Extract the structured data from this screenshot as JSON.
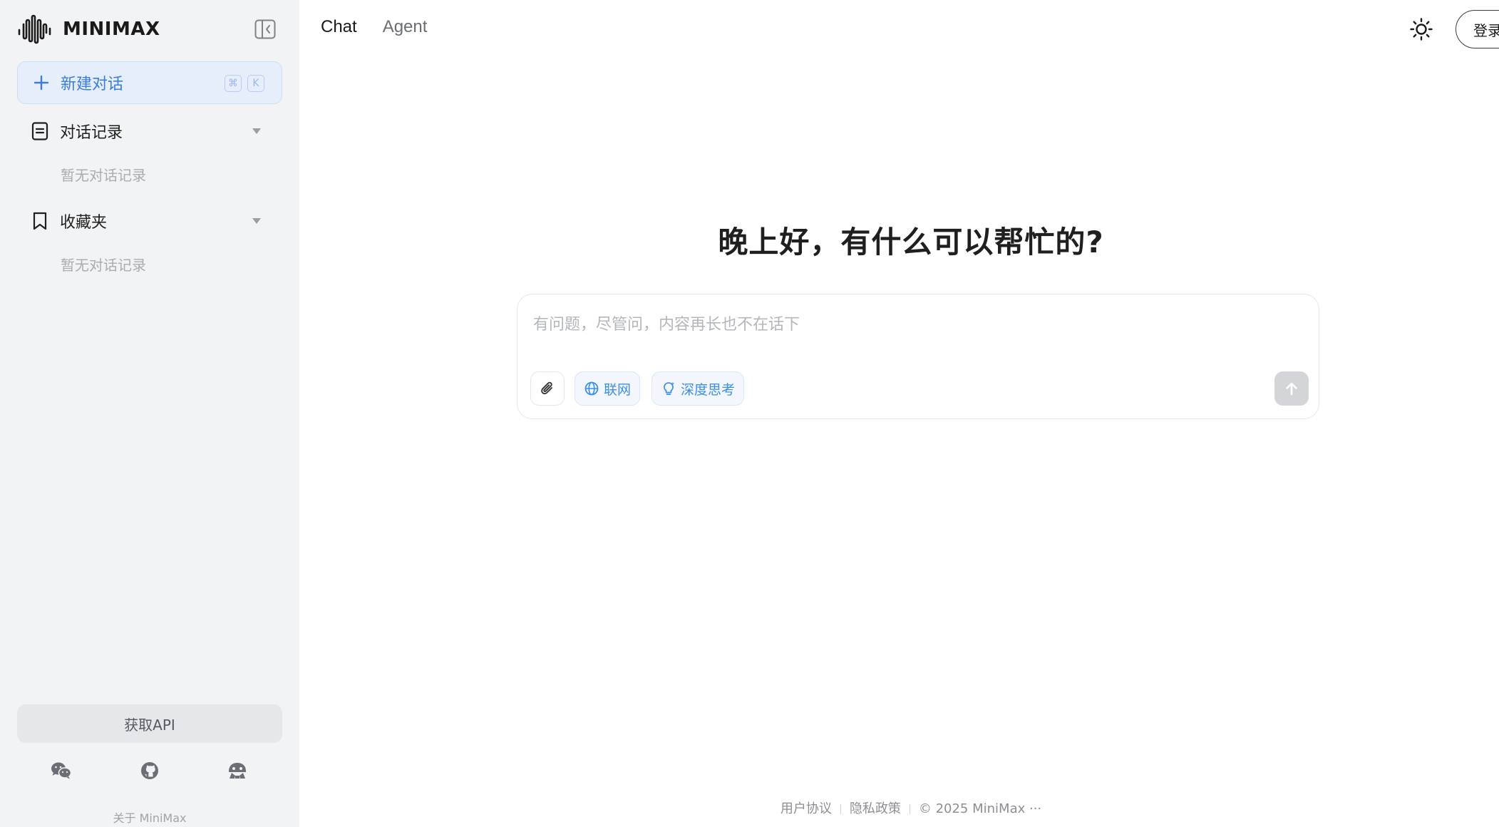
{
  "brand": {
    "name": "MINIMAX"
  },
  "sidebar": {
    "new_chat": {
      "label": "新建对话",
      "shortcut_keys": [
        "⌘",
        "K"
      ]
    },
    "sections": [
      {
        "label": "对话记录",
        "empty_text": "暂无对话记录",
        "icon": "document-icon"
      },
      {
        "label": "收藏夹",
        "empty_text": "暂无对话记录",
        "icon": "bookmark-icon"
      }
    ],
    "api_button": "获取API",
    "social_icons": [
      "wechat-icon",
      "github-icon",
      "community-icon"
    ],
    "about": "关于 MiniMax"
  },
  "header": {
    "tabs": [
      {
        "label": "Chat",
        "active": true
      },
      {
        "label": "Agent",
        "active": false
      }
    ],
    "theme_icon": "sun-icon",
    "login_label": "登录"
  },
  "main": {
    "greeting": "晚上好，有什么可以帮忙的?",
    "composer": {
      "placeholder": "有问题，尽管问，内容再长也不在话下",
      "value": "",
      "chips": [
        {
          "label": "联网",
          "icon": "globe-icon"
        },
        {
          "label": "深度思考",
          "icon": "bulb-icon"
        }
      ]
    }
  },
  "footer": {
    "links": [
      "用户协议",
      "隐私政策"
    ],
    "copyright": "© 2025 MiniMax",
    "more": "···"
  },
  "colors": {
    "sidebar_bg": "#f2f3f5",
    "accent_blue": "#3b7de0",
    "chip_blue": "#3b8fe8",
    "send_disabled": "#d3d5d9"
  }
}
